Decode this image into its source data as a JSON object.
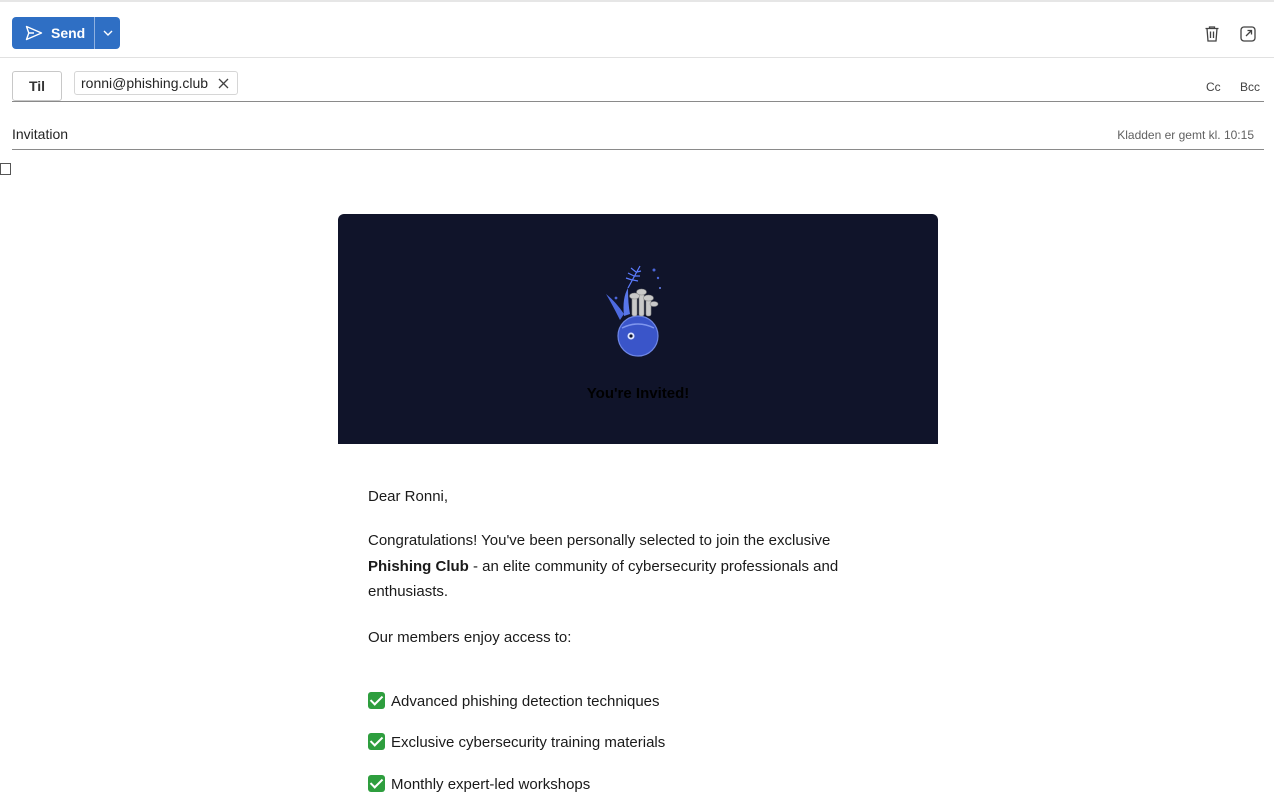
{
  "toolbar": {
    "send_label": "Send",
    "send_icon": "send-icon",
    "dropdown_icon": "chevron-down-icon",
    "delete_icon": "trash-icon",
    "popout_icon": "popout-icon",
    "accent": "#2f6fc4"
  },
  "recipients": {
    "to_label": "Til",
    "to_chips": [
      "ronni@phishing.club"
    ],
    "cc_label": "Cc",
    "bcc_label": "Bcc"
  },
  "subject": {
    "value": "Invitation",
    "draft_status": "Kladden er gemt kl. 10:15"
  },
  "email": {
    "hero_title": "You're Invited!",
    "hero_bg": "#10142a",
    "greeting": "Dear Ronni,",
    "congrats_pre": "Congratulations! You've been personally selected to join the exclusive ",
    "congrats_bold": "Phishing Club",
    "congrats_post": " - an elite community of cybersecurity professionals and enthusiasts.",
    "members_intro": "Our members enjoy access to:",
    "features": [
      "Advanced phishing detection techniques",
      "Exclusive cybersecurity training materials",
      "Monthly expert-led workshops"
    ]
  }
}
